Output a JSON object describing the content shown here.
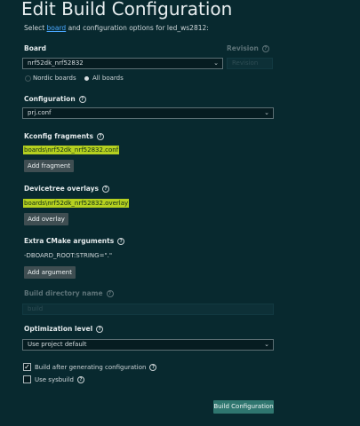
{
  "page": {
    "title": "Edit Build Configuration",
    "subtitle_prefix": "Select ",
    "subtitle_link": "board",
    "subtitle_suffix": " and configuration options for led_ws2812:"
  },
  "board": {
    "label": "Board",
    "value": "nrf52dk_nrf52832",
    "revision_label": "Revision",
    "revision_placeholder": "Revision",
    "options": [
      "Nordic boards",
      "All boards"
    ],
    "selected_option": "All boards"
  },
  "configuration": {
    "label": "Configuration",
    "value": "prj.conf"
  },
  "kconfig": {
    "label": "Kconfig fragments",
    "file": "boards\\nrf52dk_nrf52832.conf",
    "button": "Add fragment"
  },
  "devicetree": {
    "label": "Devicetree overlays",
    "file": "boards\\nrf52dk_nrf52832.overlay",
    "button": "Add overlay"
  },
  "cmake": {
    "label": "Extra CMake arguments",
    "value": "-DBOARD_ROOT:STRING=\".\"",
    "button": "Add argument"
  },
  "build_dir": {
    "label": "Build directory name",
    "placeholder": "build"
  },
  "optimization": {
    "label": "Optimization level",
    "value": "Use project default"
  },
  "options": {
    "build_after": {
      "label": "Build after generating configuration",
      "checked": true
    },
    "sysbuild": {
      "label": "Use sysbuild",
      "checked": false
    }
  },
  "footer": {
    "button": "Build Configuration"
  },
  "colors": {
    "background": "#08292f",
    "link": "#4aa8ff",
    "highlight": "#b5d020",
    "primary_button": "#2f766f"
  }
}
